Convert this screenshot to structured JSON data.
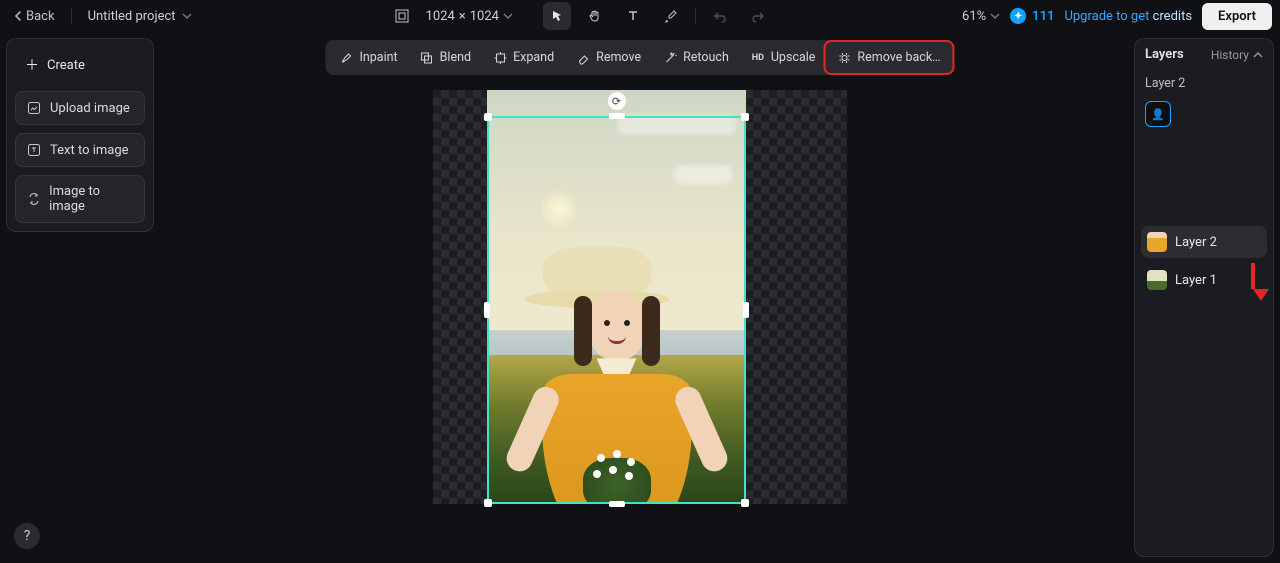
{
  "topbar": {
    "back_label": "Back",
    "project_name": "Untitled project",
    "canvas_w": "1024",
    "canvas_x": "×",
    "canvas_h": "1024",
    "zoom": "61%",
    "credits": "111",
    "upgrade_prefix": "Upgrade to get ",
    "upgrade_suffix": "credits",
    "export_label": "Export"
  },
  "left": {
    "create": "Create",
    "upload": "Upload image",
    "text2img": "Text to image",
    "img2img": "Image to image"
  },
  "tools": {
    "inpaint": "Inpaint",
    "blend": "Blend",
    "expand": "Expand",
    "remove": "Remove",
    "retouch": "Retouch",
    "upscale": "Upscale",
    "removebg": "Remove back…"
  },
  "right": {
    "layers_title": "Layers",
    "history": "History",
    "selected_layer": "Layer 2",
    "layers": [
      {
        "name": "Layer 2"
      },
      {
        "name": "Layer 1"
      }
    ]
  }
}
